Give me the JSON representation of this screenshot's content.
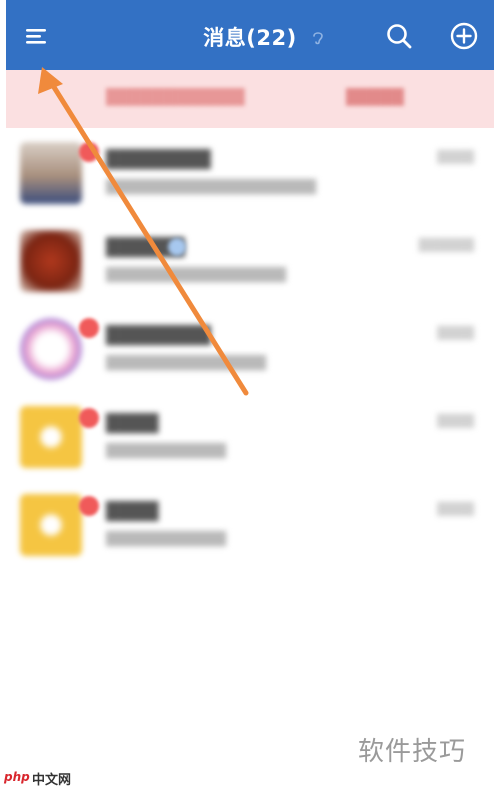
{
  "header": {
    "title": "消息(22)",
    "menu_icon": "menu-icon",
    "search_icon": "search-icon",
    "add_icon": "plus-circle-icon",
    "background": "#3371c4"
  },
  "banner": {
    "background": "#fbe0e1"
  },
  "conversations": [
    {
      "avatar_color": "#c9b6a8",
      "badge": true
    },
    {
      "avatar_color": "#b24a2a",
      "badge": false,
      "verified": true
    },
    {
      "avatar_color": "#f2a6c8",
      "badge": true
    },
    {
      "avatar_color": "#f5c542",
      "badge": true
    },
    {
      "avatar_color": "#f5c542",
      "badge": true
    }
  ],
  "annotation": {
    "arrow_color": "#f08a3c"
  },
  "watermark": {
    "text": "软件技巧",
    "logo_php": "php",
    "logo_cn": "中文网"
  }
}
